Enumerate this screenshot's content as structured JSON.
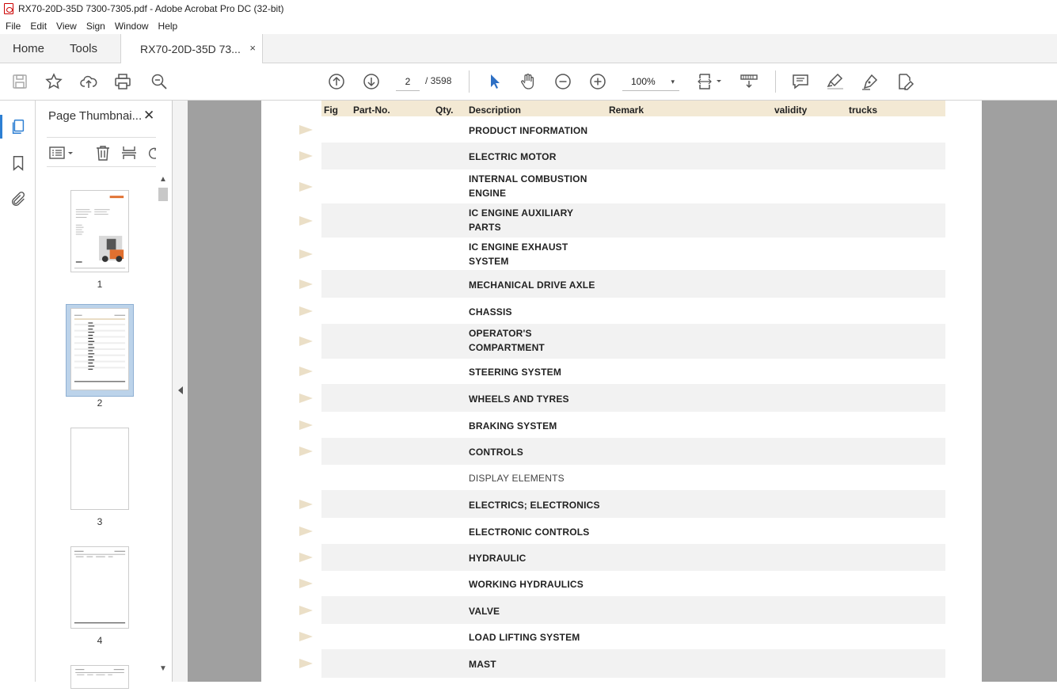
{
  "window": {
    "title": "RX70-20D-35D  7300-7305.pdf - Adobe Acrobat Pro DC (32-bit)"
  },
  "menu": [
    "File",
    "Edit",
    "View",
    "Sign",
    "Window",
    "Help"
  ],
  "tabs": {
    "home": "Home",
    "tools": "Tools",
    "document": "RX70-20D-35D  73...",
    "close": "×"
  },
  "toolbar": {
    "current_page": "2",
    "page_count": "/  3598",
    "zoom": "100%",
    "zoom_caret": "▾"
  },
  "sidebar": {
    "title": "Page Thumbnai...",
    "close": "✕",
    "thumbnails": [
      {
        "number": "1"
      },
      {
        "number": "2"
      },
      {
        "number": "3"
      },
      {
        "number": "4"
      }
    ]
  },
  "document": {
    "columns": {
      "fig": "Fig",
      "part_no": "Part-No.",
      "qty": "Qty.",
      "description": "Description",
      "remark": "Remark",
      "validity": "validity",
      "trucks": "trucks"
    },
    "rows": [
      {
        "line1": "PRODUCT INFORMATION",
        "line2": "",
        "marker": true,
        "bold": true
      },
      {
        "line1": "ELECTRIC MOTOR",
        "line2": "",
        "marker": true,
        "bold": true
      },
      {
        "line1": "INTERNAL COMBUSTION",
        "line2": "ENGINE",
        "marker": true,
        "bold": true
      },
      {
        "line1": "IC ENGINE AUXILIARY",
        "line2": "PARTS",
        "marker": true,
        "bold": true
      },
      {
        "line1": "IC ENGINE EXHAUST",
        "line2": "SYSTEM",
        "marker": true,
        "bold": true
      },
      {
        "line1": "MECHANICAL DRIVE AXLE",
        "line2": "",
        "marker": true,
        "bold": true
      },
      {
        "line1": "CHASSIS",
        "line2": "",
        "marker": true,
        "bold": true
      },
      {
        "line1": "OPERATOR'S",
        "line2": "COMPARTMENT",
        "marker": true,
        "bold": true
      },
      {
        "line1": "STEERING SYSTEM",
        "line2": "",
        "marker": true,
        "bold": true
      },
      {
        "line1": "WHEELS AND TYRES",
        "line2": "",
        "marker": true,
        "bold": true
      },
      {
        "line1": "BRAKING SYSTEM",
        "line2": "",
        "marker": true,
        "bold": true
      },
      {
        "line1": "CONTROLS",
        "line2": "",
        "marker": true,
        "bold": true
      },
      {
        "line1": "DISPLAY ELEMENTS",
        "line2": "",
        "marker": false,
        "bold": false
      },
      {
        "line1": "ELECTRICS; ELECTRONICS",
        "line2": "",
        "marker": true,
        "bold": true
      },
      {
        "line1": "ELECTRONIC CONTROLS",
        "line2": "",
        "marker": true,
        "bold": true
      },
      {
        "line1": "HYDRAULIC",
        "line2": "",
        "marker": true,
        "bold": true
      },
      {
        "line1": "WORKING HYDRAULICS",
        "line2": "",
        "marker": true,
        "bold": true
      },
      {
        "line1": "VALVE",
        "line2": "",
        "marker": true,
        "bold": true
      },
      {
        "line1": "LOAD LIFTING SYSTEM",
        "line2": "",
        "marker": true,
        "bold": true
      },
      {
        "line1": "MAST",
        "line2": "",
        "marker": true,
        "bold": true
      }
    ]
  }
}
